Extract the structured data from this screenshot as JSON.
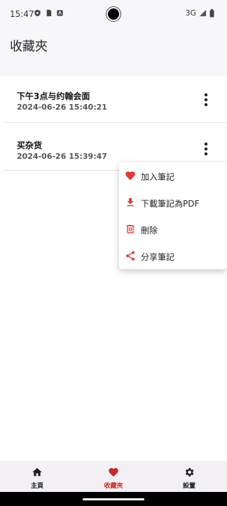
{
  "status_bar": {
    "time": "15:47",
    "network": "3G"
  },
  "app_bar": {
    "title": "收藏夾"
  },
  "notes": [
    {
      "title": "下午3点与约翰会面",
      "date": "2024-06-26 15:40:21"
    },
    {
      "title": "买杂货",
      "date": "2024-06-26 15:39:47"
    }
  ],
  "context_menu": {
    "items": [
      {
        "label": "加入筆記",
        "icon": "heart-icon"
      },
      {
        "label": "下載筆記為PDF",
        "icon": "download-icon"
      },
      {
        "label": "刪除",
        "icon": "trash-icon"
      },
      {
        "label": "分享筆記",
        "icon": "share-icon"
      }
    ]
  },
  "bottom_nav": {
    "items": [
      {
        "label": "主頁",
        "icon": "home-icon",
        "active": false
      },
      {
        "label": "收藏夾",
        "icon": "heart-icon",
        "active": true
      },
      {
        "label": "設置",
        "icon": "gear-icon",
        "active": false
      }
    ]
  },
  "colors": {
    "accent": "#e53935",
    "active_nav": "#c62828",
    "icon_dark": "#1c1b1f"
  }
}
